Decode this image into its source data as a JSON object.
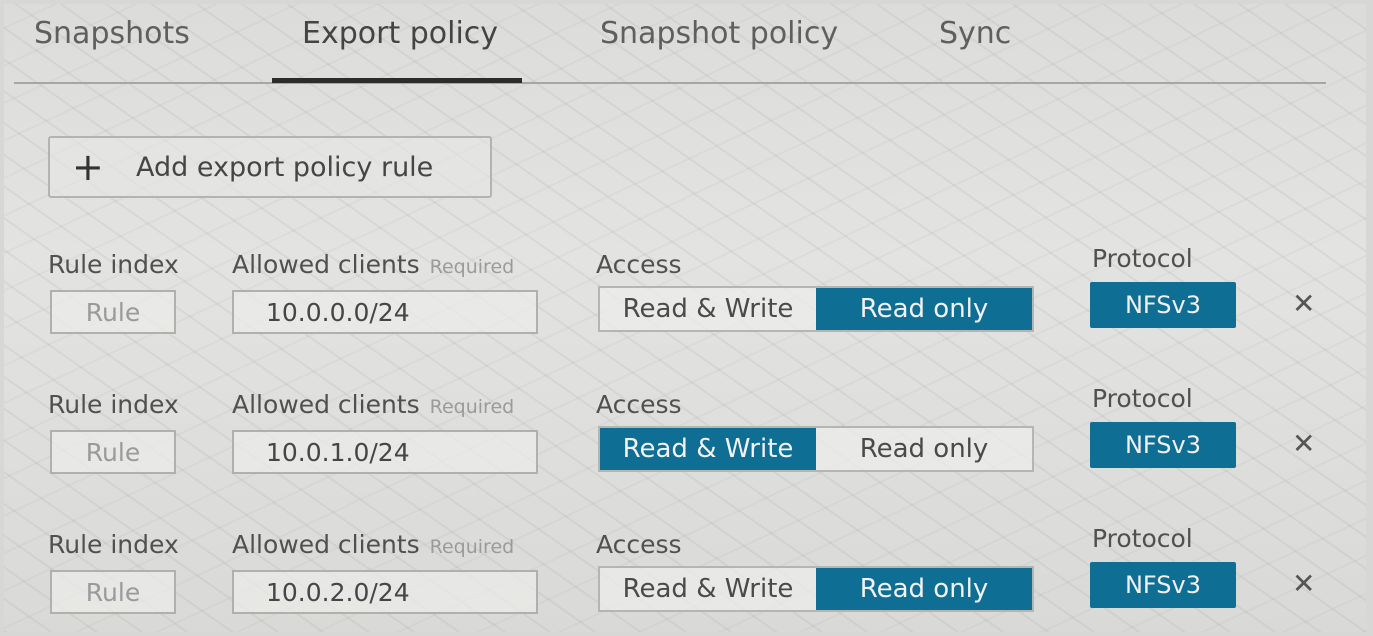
{
  "tabs": [
    {
      "label": "Snapshots",
      "active": false
    },
    {
      "label": "Export policy",
      "active": true
    },
    {
      "label": "Snapshot policy",
      "active": false
    },
    {
      "label": "Sync",
      "active": false
    }
  ],
  "add_rule": {
    "icon": "plus-icon",
    "label": "Add export policy rule"
  },
  "rules": [
    {
      "rule_index_label": "Rule index",
      "rule_placeholder": "Rule",
      "clients_label": "Allowed clients",
      "required": "Required",
      "clients_value": "10.0.0.0/24",
      "access_label": "Access",
      "access_options": [
        "Read & Write",
        "Read only"
      ],
      "access_selected": "Read only",
      "protocol_label": "Protocol",
      "protocol": "NFSv3"
    },
    {
      "rule_index_label": "Rule index",
      "rule_placeholder": "Rule",
      "clients_label": "Allowed clients",
      "required": "Required",
      "clients_value": "10.0.1.0/24",
      "access_label": "Access",
      "access_options": [
        "Read & Write",
        "Read only"
      ],
      "access_selected": "Read & Write",
      "protocol_label": "Protocol",
      "protocol": "NFSv3"
    },
    {
      "rule_index_label": "Rule index",
      "rule_placeholder": "Rule",
      "clients_label": "Allowed clients",
      "required": "Required",
      "clients_value": "10.0.2.0/24",
      "access_label": "Access",
      "access_options": [
        "Read & Write",
        "Read only"
      ],
      "access_selected": "Read only",
      "protocol_label": "Protocol",
      "protocol": "NFSv3"
    }
  ],
  "colors": {
    "accent": "#0f6e93",
    "background": "#dcdcda"
  }
}
